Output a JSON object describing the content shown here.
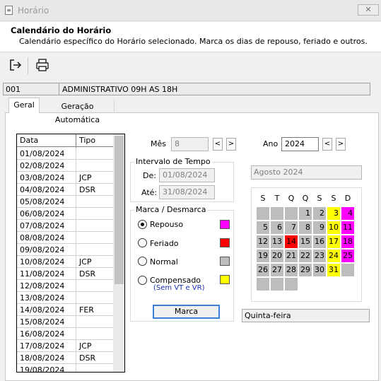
{
  "window": {
    "title": "Horário",
    "close": "✕"
  },
  "header": {
    "title": "Calendário do Horário",
    "subtitle": "Calendário específico do Horário selecionado. Marca os dias de repouso, feriado e outros."
  },
  "toolbar": {
    "exit_icon": "exit-icon",
    "print_icon": "printer-icon"
  },
  "schedule": {
    "code": "001",
    "name": "ADMINISTRATIVO 09H AS 18H"
  },
  "tabs": [
    "Geral",
    "Geração Automática"
  ],
  "grid": {
    "headers": [
      "Data",
      "Tipo"
    ],
    "rows": [
      [
        "01/08/2024",
        ""
      ],
      [
        "02/08/2024",
        ""
      ],
      [
        "03/08/2024",
        "JCP"
      ],
      [
        "04/08/2024",
        "DSR"
      ],
      [
        "05/08/2024",
        ""
      ],
      [
        "06/08/2024",
        ""
      ],
      [
        "07/08/2024",
        ""
      ],
      [
        "08/08/2024",
        ""
      ],
      [
        "09/08/2024",
        ""
      ],
      [
        "10/08/2024",
        "JCP"
      ],
      [
        "11/08/2024",
        "DSR"
      ],
      [
        "12/08/2024",
        ""
      ],
      [
        "13/08/2024",
        ""
      ],
      [
        "14/08/2024",
        "FER"
      ],
      [
        "15/08/2024",
        ""
      ],
      [
        "16/08/2024",
        ""
      ],
      [
        "17/08/2024",
        "JCP"
      ],
      [
        "18/08/2024",
        "DSR"
      ],
      [
        "19/08/2024",
        ""
      ]
    ]
  },
  "mes": {
    "label": "Mês",
    "value": "8",
    "prev": "<",
    "next": ">"
  },
  "ano": {
    "label": "Ano",
    "value": "2024",
    "prev": "<",
    "next": ">"
  },
  "intervalo": {
    "title": "Intervalo de Tempo",
    "de_label": "De:",
    "de_value": "01/08/2024",
    "ate_label": "Até:",
    "ate_value": "31/08/2024"
  },
  "marca": {
    "title": "Marca / Desmarca",
    "options": [
      {
        "label": "Repouso",
        "color": "#ff00ff",
        "selected": true
      },
      {
        "label": "Feriado",
        "color": "#ff0000",
        "selected": false
      },
      {
        "label": "Normal",
        "color": "#bdbdbd",
        "selected": false
      },
      {
        "label": "Compensado",
        "color": "#ffff00",
        "selected": false
      }
    ],
    "compensado_note": "(Sem VT e VR)",
    "button": "Marca"
  },
  "calendar": {
    "month_label": "Agosto 2024",
    "weekdays": [
      "S",
      "T",
      "Q",
      "Q",
      "S",
      "S",
      "D"
    ],
    "colors": {
      "normal": "#bdbdbd",
      "repouso": "#ff00ff",
      "feriado": "#ff0000",
      "compensado": "#ffff00"
    },
    "leading_blanks": 3,
    "days": [
      {
        "d": "1",
        "t": "normal"
      },
      {
        "d": "2",
        "t": "normal"
      },
      {
        "d": "3",
        "t": "compensado"
      },
      {
        "d": "4",
        "t": "repouso"
      },
      {
        "d": "5",
        "t": "normal"
      },
      {
        "d": "6",
        "t": "normal"
      },
      {
        "d": "7",
        "t": "normal"
      },
      {
        "d": "8",
        "t": "normal"
      },
      {
        "d": "9",
        "t": "normal"
      },
      {
        "d": "10",
        "t": "compensado"
      },
      {
        "d": "11",
        "t": "repouso"
      },
      {
        "d": "12",
        "t": "normal"
      },
      {
        "d": "13",
        "t": "normal"
      },
      {
        "d": "14",
        "t": "feriado"
      },
      {
        "d": "15",
        "t": "normal"
      },
      {
        "d": "16",
        "t": "normal"
      },
      {
        "d": "17",
        "t": "compensado"
      },
      {
        "d": "18",
        "t": "repouso"
      },
      {
        "d": "19",
        "t": "normal"
      },
      {
        "d": "20",
        "t": "normal"
      },
      {
        "d": "21",
        "t": "normal"
      },
      {
        "d": "22",
        "t": "normal"
      },
      {
        "d": "23",
        "t": "normal"
      },
      {
        "d": "24",
        "t": "compensado"
      },
      {
        "d": "25",
        "t": "repouso"
      },
      {
        "d": "26",
        "t": "normal"
      },
      {
        "d": "27",
        "t": "normal"
      },
      {
        "d": "28",
        "t": "normal"
      },
      {
        "d": "29",
        "t": "normal"
      },
      {
        "d": "30",
        "t": "normal"
      },
      {
        "d": "31",
        "t": "compensado"
      }
    ],
    "trailing_blanks": 4,
    "selected_weekday": "Quinta-feira"
  }
}
